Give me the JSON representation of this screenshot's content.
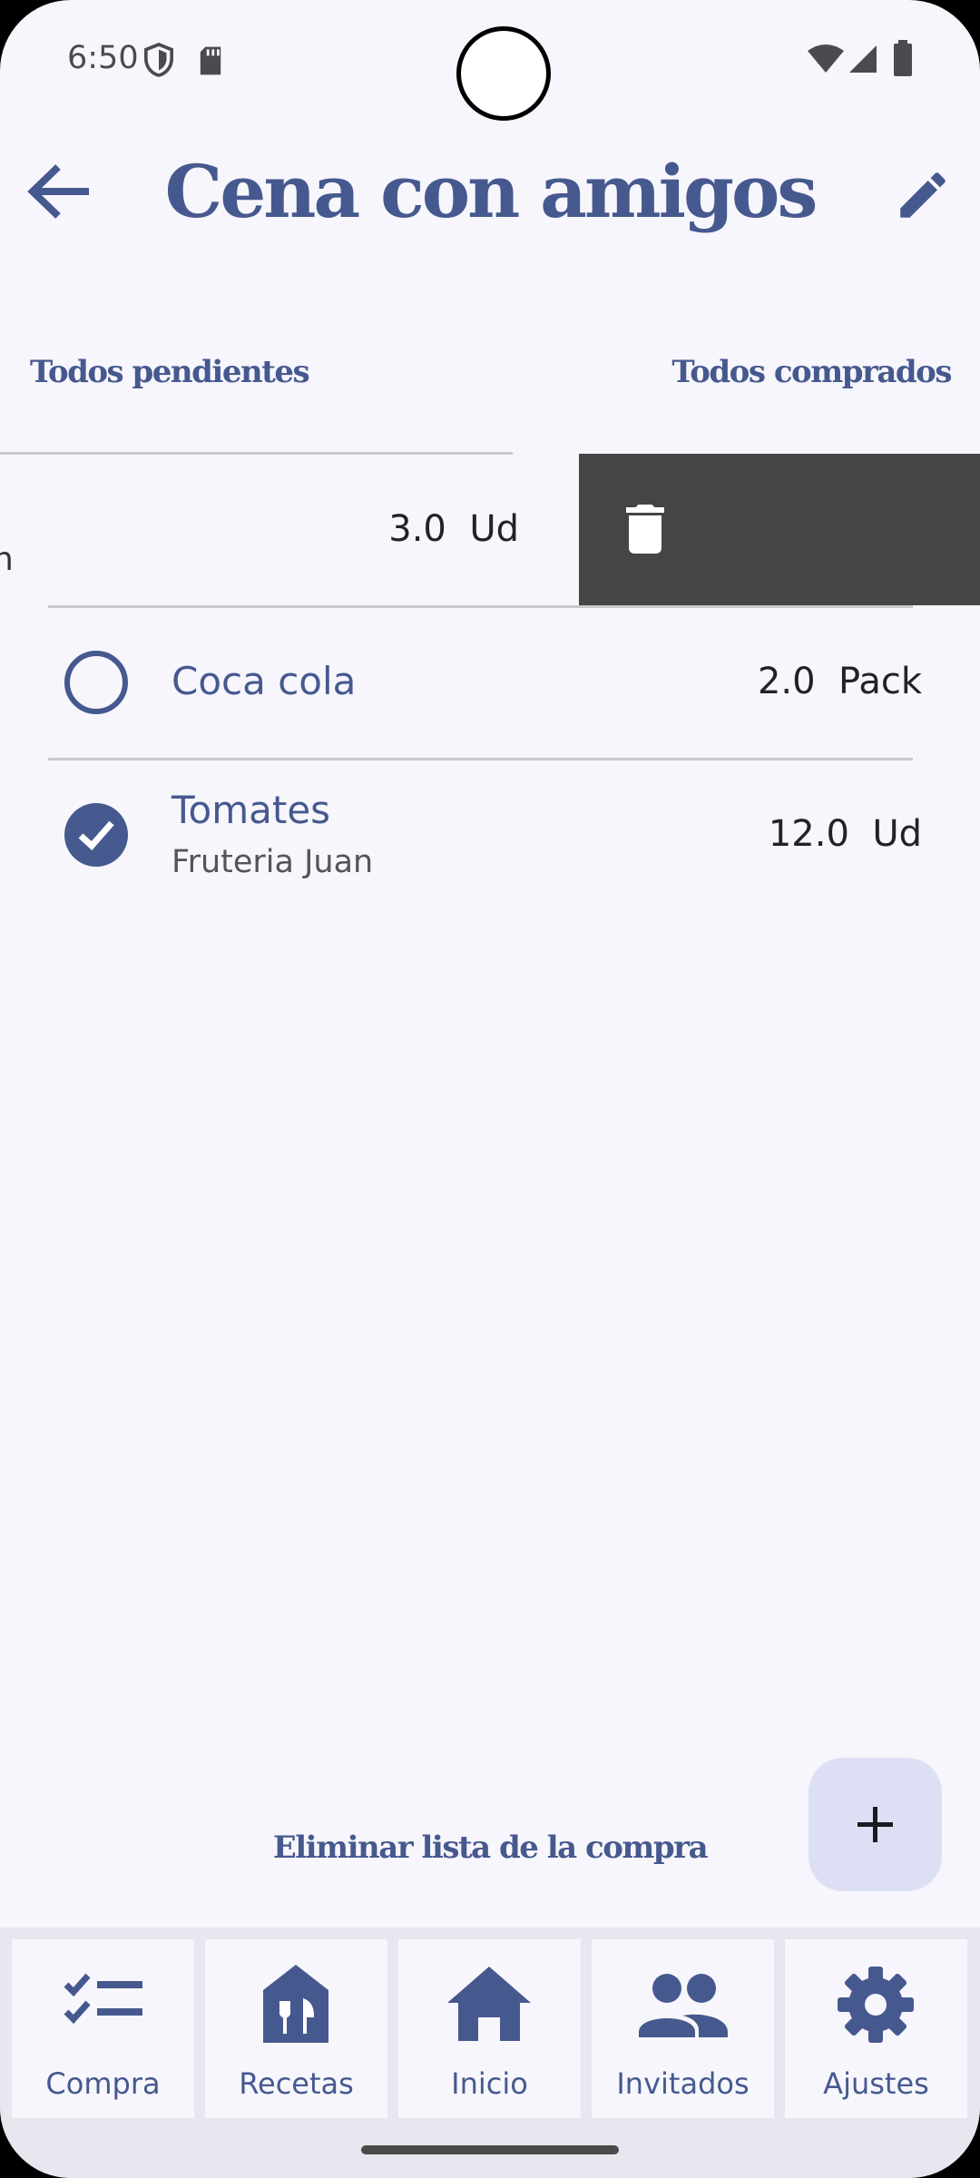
{
  "status_bar": {
    "time": "6:50"
  },
  "header": {
    "title": "Cena con amigos"
  },
  "actions": {
    "all_pending": "Todos pendientes",
    "all_purchased": "Todos comprados"
  },
  "items": [
    {
      "name": "",
      "partial_char": "n",
      "quantity": "3.0",
      "unit": "Ud",
      "checked": false,
      "swiped": true
    },
    {
      "name": "Coca cola",
      "quantity": "2.0",
      "unit": "Pack",
      "checked": false
    },
    {
      "name": "Tomates",
      "store": "Fruteria Juan",
      "quantity": "12.0",
      "unit": "Ud",
      "checked": true
    }
  ],
  "footer": {
    "delete_list": "Eliminar lista de la compra",
    "add_icon": "plus-icon"
  },
  "bottom_nav": [
    {
      "label": "Compra",
      "icon": "checklist-icon"
    },
    {
      "label": "Recetas",
      "icon": "restaurant-house-icon"
    },
    {
      "label": "Inicio",
      "icon": "home-icon"
    },
    {
      "label": "Invitados",
      "icon": "people-icon"
    },
    {
      "label": "Ajustes",
      "icon": "gear-icon"
    }
  ],
  "colors": {
    "accent": "#46598f",
    "background": "#f7f6fc",
    "swipe_bg": "#454545",
    "fab_bg": "#dde0f5"
  }
}
